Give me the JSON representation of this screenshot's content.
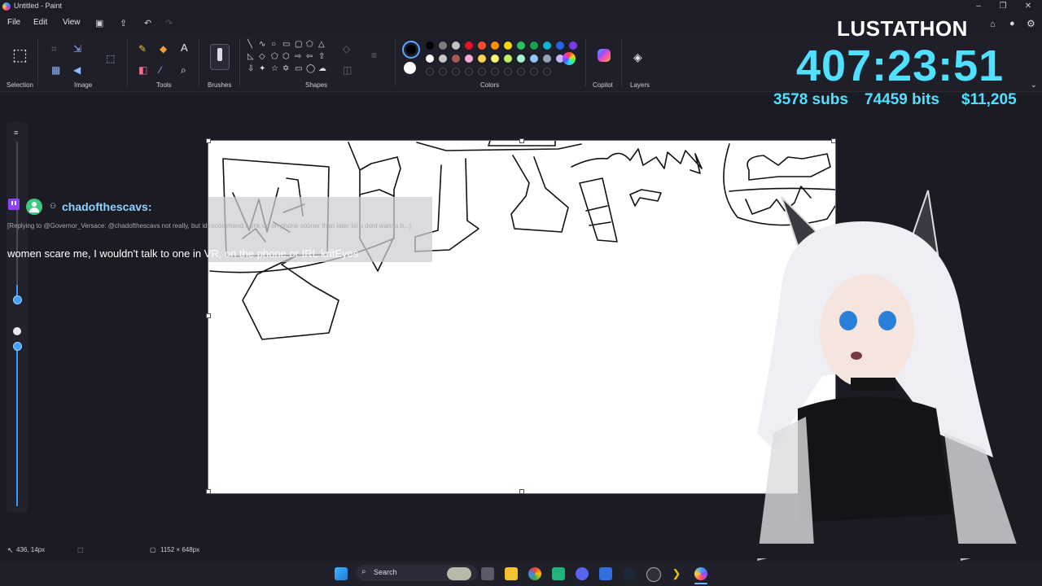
{
  "window": {
    "title": "Untitled - Paint",
    "minimize_label": "–",
    "maximize_label": "❐",
    "close_label": "✕"
  },
  "menu": {
    "file": "File",
    "edit": "Edit",
    "view": "View"
  },
  "ribbon": {
    "groups": {
      "selection": "Selection",
      "image": "Image",
      "tools": "Tools",
      "brushes": "Brushes",
      "shapes": "Shapes",
      "colors": "Colors",
      "copilot": "Copilot",
      "layers": "Layers"
    },
    "palette_row1": [
      "#000000",
      "#7f7f7f",
      "#c3c3c3",
      "#e81123",
      "#ff4b2b",
      "#ff8c00",
      "#ffd700",
      "#22c55e",
      "#16a34a",
      "#06b6d4",
      "#2563eb",
      "#7c3aed"
    ],
    "palette_row2": [
      "#ffffff",
      "#c8c8c8",
      "#a05a50",
      "#f9a8d4",
      "#fcd34d",
      "#fff176",
      "#bef264",
      "#a7f3d0",
      "#93c5fd",
      "#94a3b8",
      "#c4b5fd"
    ],
    "primary_color": "#000000",
    "secondary_color": "#ffffff"
  },
  "chat": {
    "username": "chadofthescavs:",
    "reply_text": "[Replying to @Governor_Versace: @chadofthescavs not really, but id recommend a link up on phone sooner than later lol u dont wanna b...]",
    "message": "women scare me, I wouldn't talk to one in VR, on the phone or IRL kritEyes"
  },
  "overlay": {
    "event": "LUSTATHON",
    "timer": "407:23:51",
    "subs": "3578 subs",
    "bits": "74459 bits",
    "money": "$11,205"
  },
  "status": {
    "cursor_pos": "436, 14px",
    "canvas_size": "1152 × 648px"
  },
  "taskbar": {
    "search_label": "Search"
  }
}
